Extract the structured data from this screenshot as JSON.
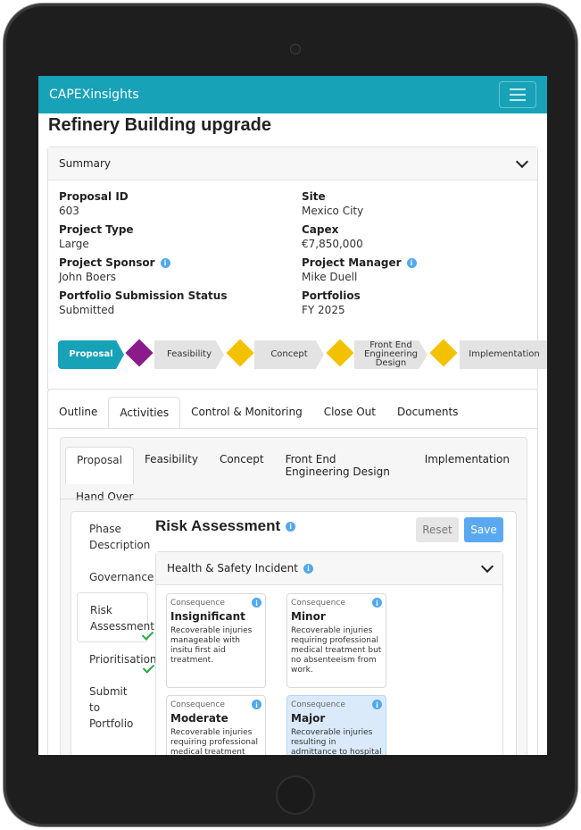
{
  "app": {
    "brand": "CAPEXinsights"
  },
  "page": {
    "title": "Refinery Building upgrade"
  },
  "summary": {
    "header": "Summary",
    "fields": [
      {
        "label": "Proposal ID",
        "value": "603",
        "info": false
      },
      {
        "label": "Site",
        "value": "Mexico City",
        "info": false
      },
      {
        "label": "Project Type",
        "value": "Large",
        "info": false
      },
      {
        "label": "Capex",
        "value": "€7,850,000",
        "info": false
      },
      {
        "label": "Project Sponsor",
        "value": "John Boers",
        "info": true
      },
      {
        "label": "Project Manager",
        "value": "Mike Duell",
        "info": true
      },
      {
        "label": "Portfolio Submission Status",
        "value": "Submitted",
        "info": false
      },
      {
        "label": "Portfolios",
        "value": "FY 2025",
        "info": false
      }
    ],
    "phases": [
      "Proposal",
      "Feasibility",
      "Concept",
      "Front End\nEngineering\nDesign",
      "Implementation"
    ],
    "phase_colors": {
      "active": "#17a2b8",
      "inactive": "#e3e3e3",
      "gate_purple": "#8b1a8b",
      "gate_yellow": "#f2c200"
    }
  },
  "tabs": [
    "Outline",
    "Activities",
    "Control & Monitoring",
    "Close Out",
    "Documents"
  ],
  "active_tab": "Activities",
  "phase_tabs": [
    "Proposal",
    "Feasibility",
    "Concept",
    "Front End Engineering Design",
    "Implementation",
    "Hand Over"
  ],
  "active_phase_tab": "Proposal",
  "sidenav": [
    {
      "label": "Phase Description",
      "complete": false
    },
    {
      "label": "Governance",
      "complete": false
    },
    {
      "label": "Risk Assessment",
      "complete": true
    },
    {
      "label": "Prioritisation",
      "complete": true
    },
    {
      "label": "Submit to Portfolio",
      "complete": false
    }
  ],
  "risk": {
    "title": "Risk Assessment",
    "reset_label": "Reset",
    "save_label": "Save",
    "section_title": "Health & Safety Incident",
    "consequence_label": "Consequence",
    "consequences": [
      {
        "name": "Insignificant",
        "desc": "Recoverable injuries manageable with insitu first aid treatment.",
        "selected": false
      },
      {
        "name": "Minor",
        "desc": "Recoverable injuries requiring professional medical treatment but no absenteeism from work.",
        "selected": false
      },
      {
        "name": "Moderate",
        "desc": "Recoverable injuries requiring professional medical treatment and",
        "selected": false
      },
      {
        "name": "Major",
        "desc": "Recoverable injuries resulting in admittance to hospital for treatment",
        "selected": true
      }
    ]
  }
}
